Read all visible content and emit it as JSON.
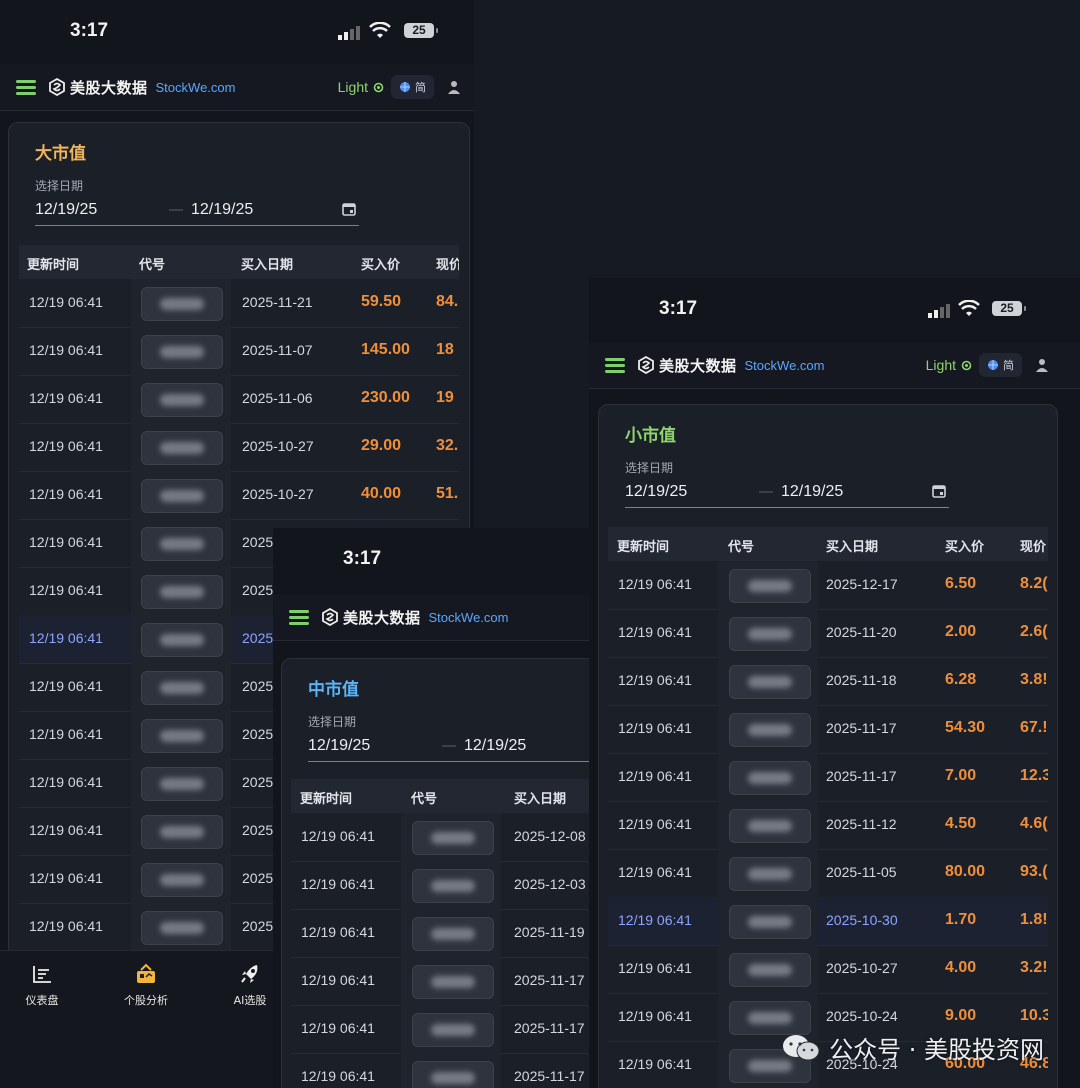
{
  "status": {
    "time": "3:17",
    "battery": "25"
  },
  "brand": {
    "cn": "美股大数据",
    "en": "StockWe.com"
  },
  "nav": {
    "light_label": "Light",
    "lang_label": "简"
  },
  "date": {
    "label": "选择日期",
    "start": "12/19/25",
    "end": "12/19/25"
  },
  "columns": {
    "update_time": "更新时间",
    "code": "代号",
    "buy_date": "买入日期",
    "buy_price": "买入价",
    "current_price": "现价"
  },
  "large": {
    "title": "大市值",
    "rows": [
      {
        "time": "12/19 06:41",
        "date": "2025-11-21",
        "price": "59.50",
        "current": "84."
      },
      {
        "time": "12/19 06:41",
        "date": "2025-11-07",
        "price": "145.00",
        "current": "18"
      },
      {
        "time": "12/19 06:41",
        "date": "2025-11-06",
        "price": "230.00",
        "current": "19"
      },
      {
        "time": "12/19 06:41",
        "date": "2025-10-27",
        "price": "29.00",
        "current": "32."
      },
      {
        "time": "12/19 06:41",
        "date": "2025-10-27",
        "price": "40.00",
        "current": "51."
      },
      {
        "time": "12/19 06:41",
        "date": "2025",
        "price": "",
        "current": ""
      },
      {
        "time": "12/19 06:41",
        "date": "2025",
        "price": "",
        "current": ""
      },
      {
        "time": "12/19 06:41",
        "date": "2025",
        "price": "",
        "current": "",
        "highlight": true
      },
      {
        "time": "12/19 06:41",
        "date": "2025",
        "price": "",
        "current": ""
      },
      {
        "time": "12/19 06:41",
        "date": "2025",
        "price": "",
        "current": ""
      },
      {
        "time": "12/19 06:41",
        "date": "2025",
        "price": "",
        "current": ""
      },
      {
        "time": "12/19 06:41",
        "date": "2025",
        "price": "",
        "current": ""
      },
      {
        "time": "12/19 06:41",
        "date": "2025",
        "price": "",
        "current": ""
      },
      {
        "time": "12/19 06:41",
        "date": "2025",
        "price": "",
        "current": ""
      }
    ]
  },
  "mid": {
    "title": "中市值",
    "rows": [
      {
        "time": "12/19 06:41",
        "date": "2025-12-08"
      },
      {
        "time": "12/19 06:41",
        "date": "2025-12-03"
      },
      {
        "time": "12/19 06:41",
        "date": "2025-11-19"
      },
      {
        "time": "12/19 06:41",
        "date": "2025-11-17"
      },
      {
        "time": "12/19 06:41",
        "date": "2025-11-17"
      },
      {
        "time": "12/19 06:41",
        "date": "2025-11-17"
      }
    ]
  },
  "small": {
    "title": "小市值",
    "rows": [
      {
        "time": "12/19 06:41",
        "date": "2025-12-17",
        "price": "6.50",
        "current": "8.2("
      },
      {
        "time": "12/19 06:41",
        "date": "2025-11-20",
        "price": "2.00",
        "current": "2.6("
      },
      {
        "time": "12/19 06:41",
        "date": "2025-11-18",
        "price": "6.28",
        "current": "3.8!"
      },
      {
        "time": "12/19 06:41",
        "date": "2025-11-17",
        "price": "54.30",
        "current": "67.!"
      },
      {
        "time": "12/19 06:41",
        "date": "2025-11-17",
        "price": "7.00",
        "current": "12.3"
      },
      {
        "time": "12/19 06:41",
        "date": "2025-11-12",
        "price": "4.50",
        "current": "4.6("
      },
      {
        "time": "12/19 06:41",
        "date": "2025-11-05",
        "price": "80.00",
        "current": "93.("
      },
      {
        "time": "12/19 06:41",
        "date": "2025-10-30",
        "price": "1.70",
        "current": "1.8!",
        "highlight": true
      },
      {
        "time": "12/19 06:41",
        "date": "2025-10-27",
        "price": "4.00",
        "current": "3.2!"
      },
      {
        "time": "12/19 06:41",
        "date": "2025-10-24",
        "price": "9.00",
        "current": "10.3"
      },
      {
        "time": "12/19 06:41",
        "date": "2025-10-24",
        "price": "60.00",
        "current": "46.8"
      }
    ]
  },
  "bottom_tabs": [
    {
      "label": "仪表盘",
      "icon": "dashboard-icon"
    },
    {
      "label": "个股分析",
      "icon": "stock-analysis-icon"
    },
    {
      "label": "AI选股",
      "icon": "rocket-icon"
    }
  ],
  "watermark": "公众号 · 美股投资网",
  "colors": {
    "accent_green": "#7fd06a",
    "brand_blue": "#5aa7ff",
    "price_orange": "#f08f3b",
    "large_title": "#f0b45a",
    "mid_title": "#5ab4f5",
    "small_title": "#8fd46f"
  }
}
